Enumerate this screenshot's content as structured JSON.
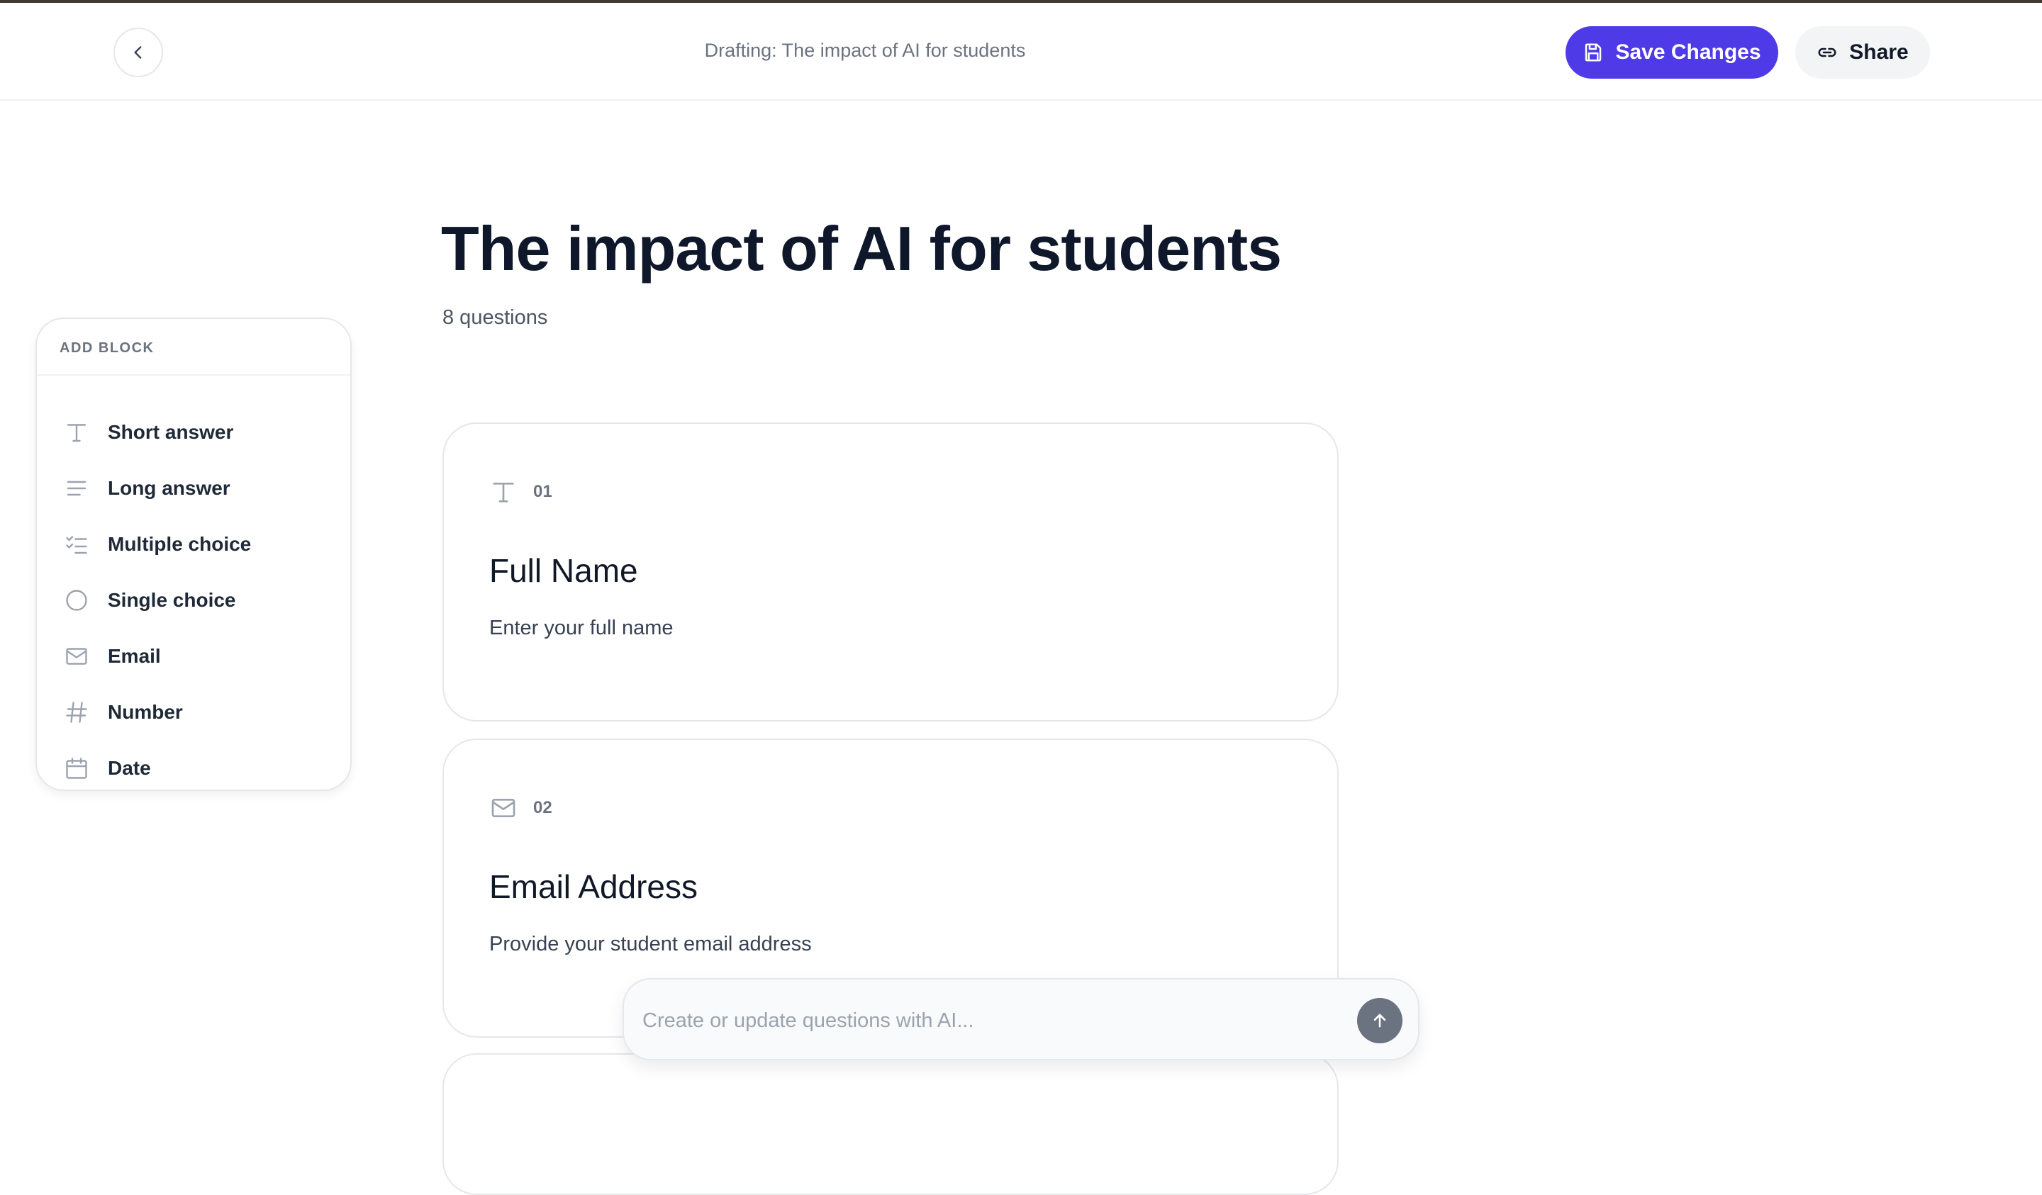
{
  "header": {
    "draft_title": "Drafting: The impact of AI for students",
    "save_label": "Save Changes",
    "share_label": "Share"
  },
  "form": {
    "title": "The impact of AI for students",
    "question_count": "8 questions"
  },
  "add_block": {
    "heading": "ADD BLOCK",
    "items": [
      {
        "label": "Short answer",
        "icon": "text-t-icon"
      },
      {
        "label": "Long answer",
        "icon": "lines-icon"
      },
      {
        "label": "Multiple choice",
        "icon": "checklist-icon"
      },
      {
        "label": "Single choice",
        "icon": "circle-icon"
      },
      {
        "label": "Email",
        "icon": "mail-icon"
      },
      {
        "label": "Number",
        "icon": "hash-icon"
      },
      {
        "label": "Date",
        "icon": "calendar-icon"
      }
    ]
  },
  "questions": [
    {
      "number": "01",
      "title": "Full Name",
      "description": "Enter your full name",
      "icon": "text-t-icon"
    },
    {
      "number": "02",
      "title": "Email Address",
      "description": "Provide your student email address",
      "icon": "mail-icon"
    }
  ],
  "ai": {
    "placeholder": "Create or update questions with AI..."
  },
  "colors": {
    "accent": "#4f3ae8",
    "text": "#111827",
    "muted": "#6b7280"
  }
}
